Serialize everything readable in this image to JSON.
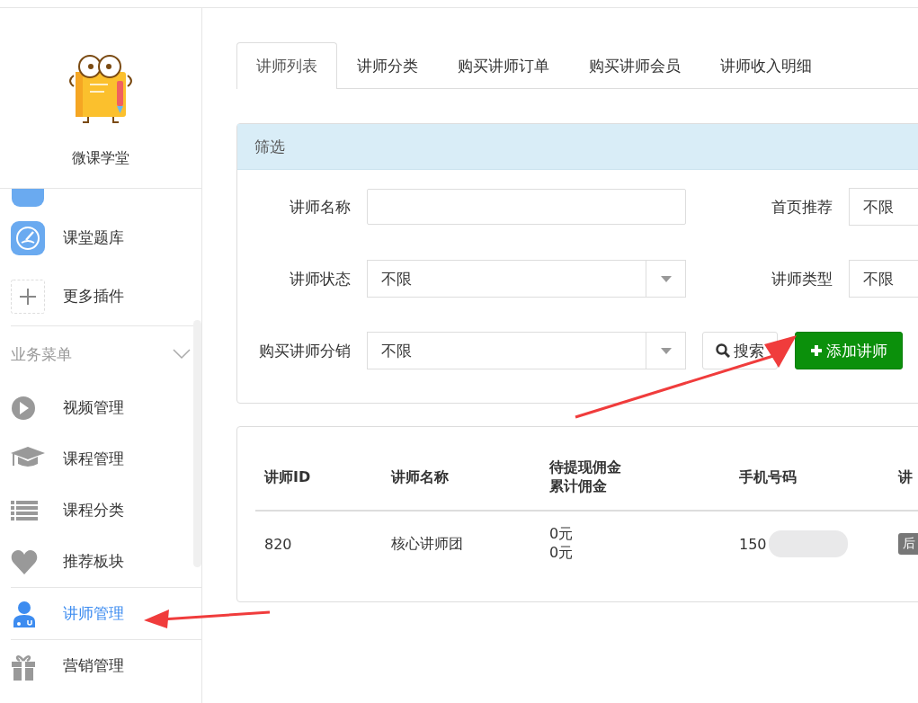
{
  "sidebar": {
    "brand": "微课学堂",
    "plugins": [
      {
        "label": "课堂题库",
        "kind": "quiz"
      },
      {
        "label": "更多插件",
        "kind": "plus"
      }
    ],
    "section": {
      "title": "业务菜单",
      "expanded": true
    },
    "items": [
      {
        "label": "视频管理",
        "kind": "play",
        "selected": false
      },
      {
        "label": "课程管理",
        "kind": "cap",
        "selected": false
      },
      {
        "label": "课程分类",
        "kind": "list",
        "selected": false
      },
      {
        "label": "推荐板块",
        "kind": "heart",
        "selected": false
      },
      {
        "label": "讲师管理",
        "kind": "teacher",
        "selected": true
      },
      {
        "label": "营销管理",
        "kind": "gift",
        "selected": false
      }
    ]
  },
  "tabs": [
    {
      "label": "讲师列表",
      "selected": true
    },
    {
      "label": "讲师分类",
      "selected": false
    },
    {
      "label": "购买讲师订单",
      "selected": false
    },
    {
      "label": "购买讲师会员",
      "selected": false
    },
    {
      "label": "讲师收入明细",
      "selected": false
    }
  ],
  "filter": {
    "title": "筛选",
    "fields": [
      {
        "label": "讲师名称",
        "kind": "text"
      },
      {
        "label": "首页推荐",
        "kind": "select_cut",
        "value": "不限"
      },
      {
        "label": "讲师状态",
        "kind": "select",
        "value": "不限"
      },
      {
        "label": "讲师类型",
        "kind": "select_cut",
        "value": "不限"
      },
      {
        "label": "购买讲师分销",
        "kind": "select",
        "value": "不限"
      }
    ],
    "search_button": "搜索",
    "add_button": "添加讲师"
  },
  "table": {
    "columns": [
      [
        "讲师ID"
      ],
      [
        "讲师名称"
      ],
      [
        "待提现佣金",
        "累计佣金"
      ],
      [
        "手机号码"
      ],
      [
        "讲"
      ]
    ],
    "rows": [
      {
        "id": "820",
        "name": "核心讲师团",
        "commission": [
          "0元",
          "0元"
        ],
        "phone": "150",
        "status": "后"
      }
    ]
  }
}
